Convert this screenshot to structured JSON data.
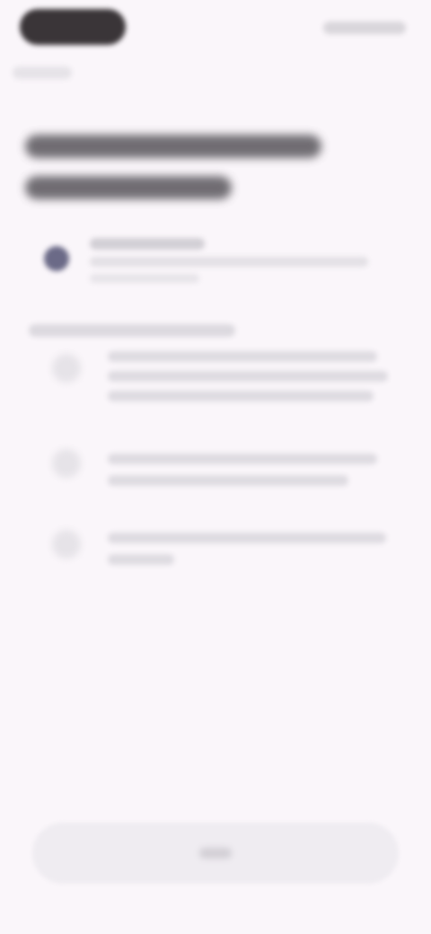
{
  "status_bar": {
    "time": "",
    "indicators": ""
  },
  "nav": {
    "back_label": ""
  },
  "header": {
    "title_line1": "",
    "title_line2": ""
  },
  "account": {
    "name": "",
    "email": "",
    "sub": ""
  },
  "permissions": {
    "heading": "",
    "items": [
      {
        "icon": "permission-icon",
        "lines": [
          "",
          "",
          ""
        ]
      },
      {
        "icon": "permission-icon",
        "lines": [
          "",
          ""
        ]
      },
      {
        "icon": "permission-icon",
        "lines": [
          "",
          ""
        ]
      }
    ]
  },
  "footer": {
    "button_label": ""
  },
  "colors": {
    "background": "#faf6fa",
    "accent": "#6b6a87"
  }
}
